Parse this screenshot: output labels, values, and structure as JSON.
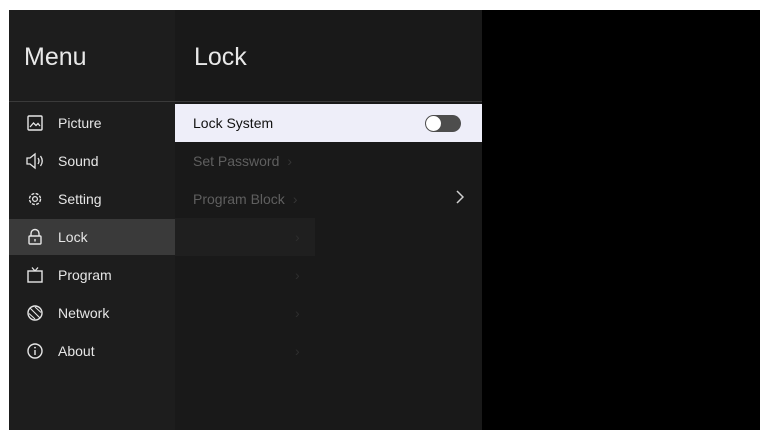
{
  "menu": {
    "title": "Menu",
    "items": [
      {
        "label": "Picture",
        "icon": "picture-icon"
      },
      {
        "label": "Sound",
        "icon": "speaker-icon"
      },
      {
        "label": "Setting",
        "icon": "gear-icon"
      },
      {
        "label": "Lock",
        "icon": "lock-icon",
        "active": true
      },
      {
        "label": "Program",
        "icon": "tv-icon"
      },
      {
        "label": "Network",
        "icon": "globe-icon"
      },
      {
        "label": "About",
        "icon": "info-icon"
      }
    ]
  },
  "lock": {
    "title": "Lock",
    "lock_system": {
      "label": "Lock System",
      "toggle_on": false
    },
    "set_password": {
      "label": "Set Password"
    },
    "program_block": {
      "label": "Program Block"
    }
  },
  "colors": {
    "background": "#000000",
    "menu_panel": "#1d1d1d",
    "lock_panel": "#191919",
    "selected_row": "#eeeef9",
    "active_menu": "#3a3a3a"
  }
}
